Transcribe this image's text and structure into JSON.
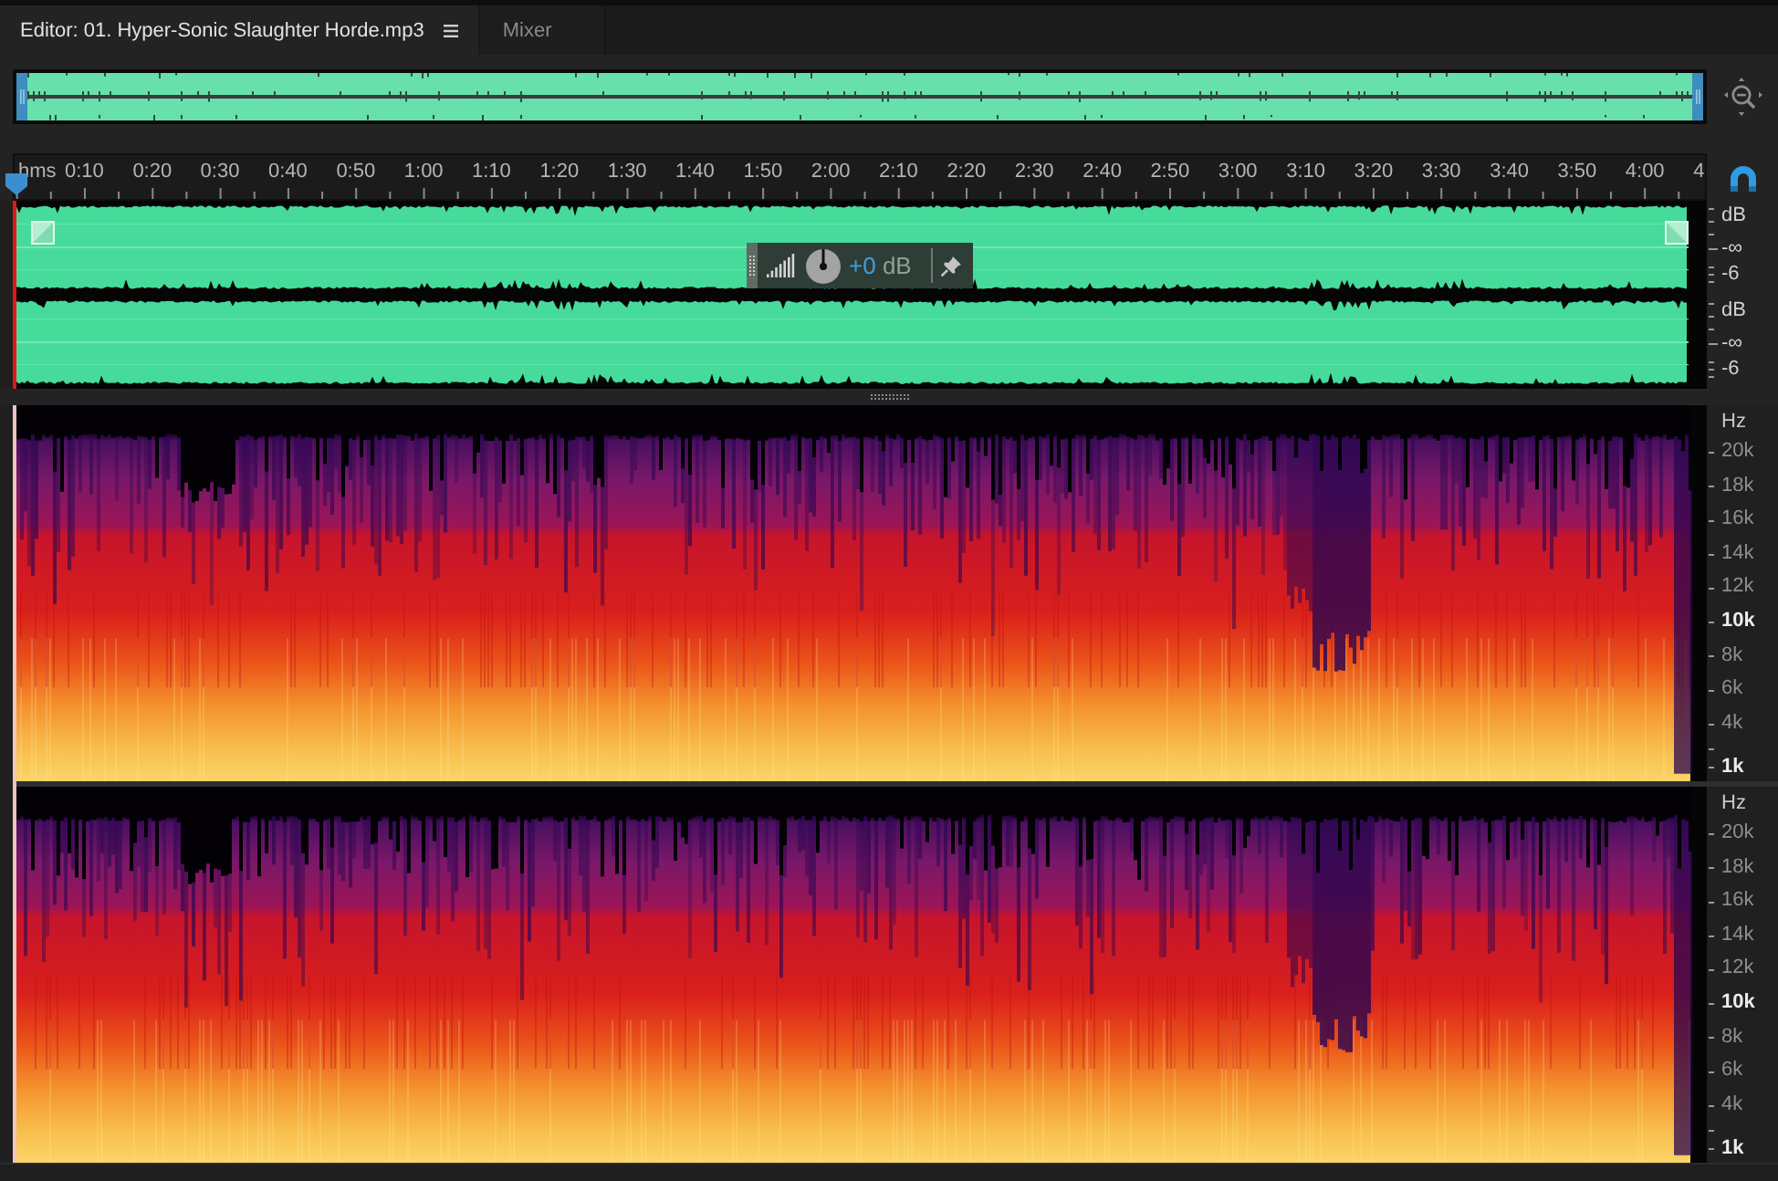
{
  "tabs": [
    {
      "label": "Editor: 01. Hyper-Sonic Slaughter Horde.mp3",
      "selected": true
    },
    {
      "label": "Mixer",
      "selected": false
    }
  ],
  "ruler": {
    "unit": "hms",
    "labels": [
      "0:10",
      "0:20",
      "0:30",
      "0:40",
      "0:50",
      "1:00",
      "1:10",
      "1:20",
      "1:30",
      "1:40",
      "1:50",
      "2:00",
      "2:10",
      "2:20",
      "2:30",
      "2:40",
      "2:50",
      "3:00",
      "3:10",
      "3:20",
      "3:30",
      "3:40",
      "3:50",
      "4:00",
      "4"
    ]
  },
  "waveform": {
    "channels": [
      {
        "scale": [
          "dB",
          "-∞",
          "-6"
        ]
      },
      {
        "scale": [
          "dB",
          "-∞",
          "-6"
        ]
      }
    ]
  },
  "gain_hud": {
    "value": "+0",
    "unit": "dB"
  },
  "spectrogram": {
    "channels": [
      {
        "unit": "Hz",
        "ticks": [
          {
            "label": "20k",
            "major": false
          },
          {
            "label": "18k",
            "major": false
          },
          {
            "label": "16k",
            "major": false
          },
          {
            "label": "14k",
            "major": false
          },
          {
            "label": "12k",
            "major": false
          },
          {
            "label": "10k",
            "major": true
          },
          {
            "label": "8k",
            "major": false
          },
          {
            "label": "6k",
            "major": false
          },
          {
            "label": "4k",
            "major": false
          },
          {
            "label": "1k",
            "major": true
          }
        ]
      },
      {
        "unit": "Hz",
        "ticks": [
          {
            "label": "20k",
            "major": false
          },
          {
            "label": "18k",
            "major": false
          },
          {
            "label": "16k",
            "major": false
          },
          {
            "label": "14k",
            "major": false
          },
          {
            "label": "12k",
            "major": false
          },
          {
            "label": "10k",
            "major": true
          },
          {
            "label": "8k",
            "major": false
          },
          {
            "label": "6k",
            "major": false
          },
          {
            "label": "4k",
            "major": false
          },
          {
            "label": "1k",
            "major": true
          }
        ]
      }
    ]
  }
}
